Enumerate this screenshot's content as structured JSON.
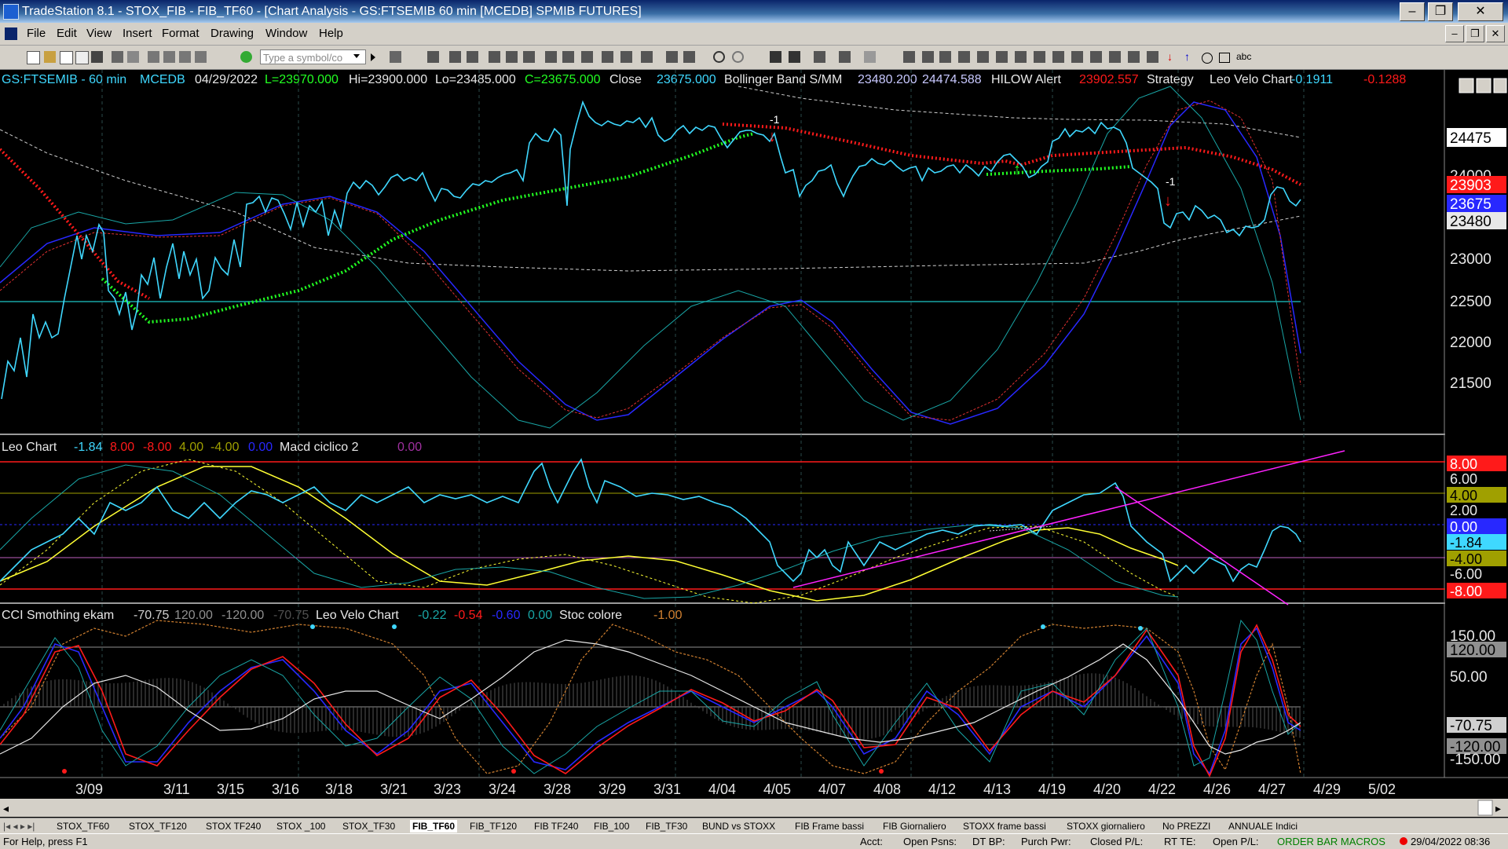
{
  "window": {
    "title": "TradeStation 8.1 - STOX_FIB - FIB_TF60 - [Chart Analysis - GS:FTSEMIB  60 min  [MCEDB] SPMIB FUTURES]",
    "minimize": "–",
    "restore": "❐",
    "close": "✕"
  },
  "menu": {
    "items": [
      "File",
      "Edit",
      "View",
      "Insert",
      "Format",
      "Drawing",
      "Window",
      "Help"
    ]
  },
  "toolbar": {
    "symbol_placeholder": "Type a symbol/co",
    "text_tool": "abc"
  },
  "header": {
    "symbol": "GS:FTSEMIB - 60 min",
    "exchange": "MCEDB",
    "date": "04/29/2022",
    "last": "L=23970.000",
    "high": "Hi=23900.000",
    "low": "Lo=23485.000",
    "close_val": "C=23675.000",
    "close_label": "Close",
    "close_num": "23675.000",
    "bb_name": "Bollinger Band S/MM",
    "bb_lo": "23480.200",
    "bb_hi": "24474.588",
    "hilow": "HILOW Alert",
    "hilow_val": "23902.557",
    "strategy": "Strategy",
    "velo": "Leo Velo Chart",
    "velo_a": "-0.1911",
    "velo_b": "-0.1288"
  },
  "pane1": {
    "y_labels": [
      "24475",
      "24000",
      "23903",
      "23675",
      "23480",
      "23000",
      "22500",
      "22000",
      "21500"
    ],
    "alerts": [
      "-1",
      "-1"
    ]
  },
  "pane2": {
    "title": "Leo Chart",
    "v1": "-1.84",
    "v2": "8.00",
    "v3": "-8.00",
    "v4": "4.00",
    "v5": "-4.00",
    "v6": "0.00",
    "macd": "Macd ciclico 2",
    "macd_val": "0.00",
    "y_labels": [
      "8.00",
      "6.00",
      "4.00",
      "2.00",
      "0.00",
      "-1.84",
      "-4.00",
      "-6.00",
      "-8.00"
    ]
  },
  "pane3": {
    "title": "CCI Smothing ekam",
    "v1": "-70.75",
    "v2": "120.00",
    "v3": "-120.00",
    "v4": "-70.75",
    "velo": "Leo Velo Chart",
    "w1": "-0.22",
    "w2": "-0.54",
    "w3": "-0.60",
    "w4": "0.00",
    "stoc": "Stoc colore",
    "stoc_val": "-1.00",
    "y_labels": [
      "150.00",
      "120.00",
      "50.00",
      "-70.75",
      "-120.00",
      "-150.00"
    ]
  },
  "x_axis": [
    "3/09",
    "3/11",
    "3/15",
    "3/16",
    "3/18",
    "3/21",
    "3/23",
    "3/24",
    "3/28",
    "3/29",
    "3/31",
    "4/04",
    "4/05",
    "4/07",
    "4/08",
    "4/12",
    "4/13",
    "4/19",
    "4/20",
    "4/22",
    "4/26",
    "4/27",
    "4/29",
    "5/02"
  ],
  "tabs": [
    "STOX_TF60",
    "STOX_TF120",
    "STOX TF240",
    "STOX _100",
    "STOX_TF30",
    "FIB_TF60",
    "FIB_TF120",
    "FIB TF240",
    "FIB_100",
    "FIB_TF30",
    "BUND vs STOXX",
    "FIB Frame bassi",
    "FIB Giornaliero",
    "STOXX frame bassi",
    "STOXX giornaliero",
    "No PREZZI",
    "ANNUALE Indici"
  ],
  "active_tab": "FIB_TF60",
  "status": {
    "help": "For Help, press F1",
    "acct": "Acct:",
    "open_psns": "Open Psns:",
    "dt_bp": "DT BP:",
    "purch": "Purch Pwr:",
    "closed": "Closed P/L:",
    "rt_te": "RT TE:",
    "open_pl": "Open P/L:",
    "macros": "ORDER BAR  MACROS",
    "datetime": "29/04/2022 08:36"
  },
  "colors": {
    "cyan": "#3fd8ff",
    "red": "#ff1a1a",
    "green": "#22ff22",
    "yellow": "#ffff33",
    "blue": "#2828ff",
    "teal": "#19a6a6",
    "magenta": "#ff22ff"
  }
}
